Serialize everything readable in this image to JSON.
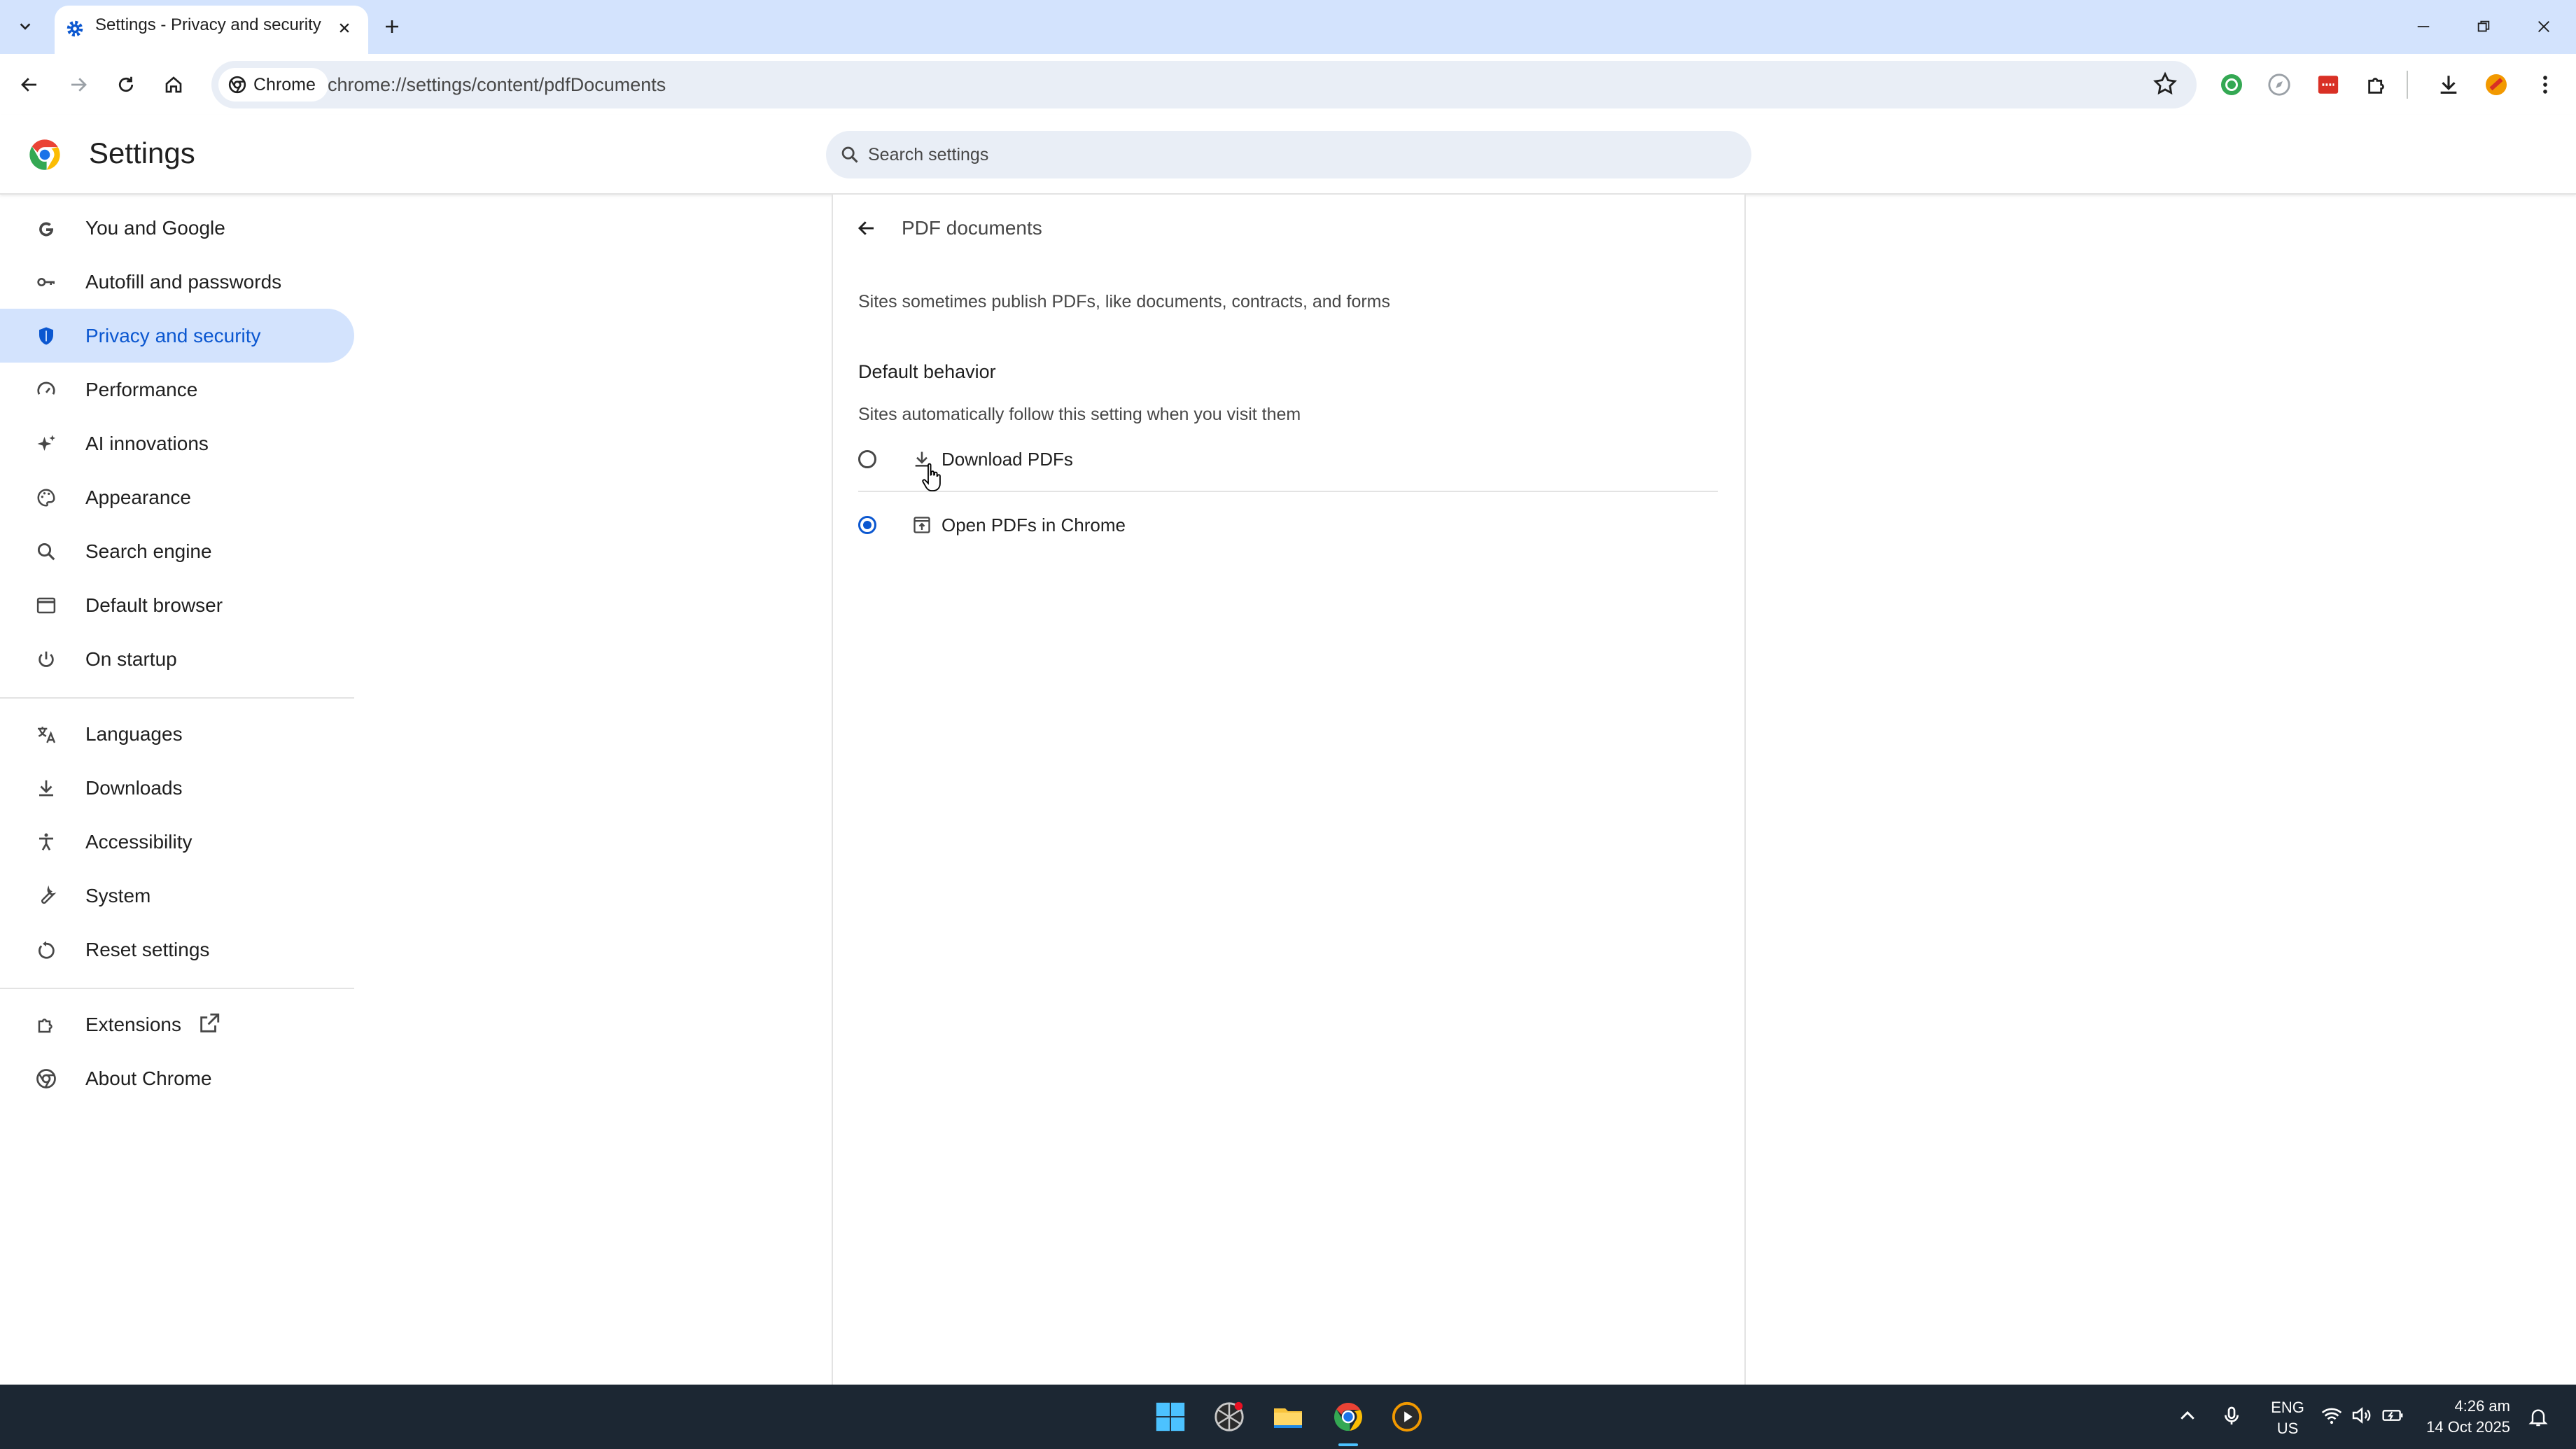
{
  "browser": {
    "tab": {
      "title": "Settings - Privacy and security"
    },
    "chip_label": "Chrome",
    "url": "chrome://settings/content/pdfDocuments"
  },
  "settings": {
    "title": "Settings",
    "search_placeholder": "Search settings"
  },
  "sidebar": {
    "items": [
      {
        "label": "You and Google",
        "icon": "google-g-icon"
      },
      {
        "label": "Autofill and passwords",
        "icon": "key-icon"
      },
      {
        "label": "Privacy and security",
        "icon": "shield-icon",
        "active": true
      },
      {
        "label": "Performance",
        "icon": "speedometer-icon"
      },
      {
        "label": "AI innovations",
        "icon": "sparkle-icon"
      },
      {
        "label": "Appearance",
        "icon": "palette-icon"
      },
      {
        "label": "Search engine",
        "icon": "search-icon"
      },
      {
        "label": "Default browser",
        "icon": "browser-window-icon"
      },
      {
        "label": "On startup",
        "icon": "power-icon"
      },
      {
        "label": "Languages",
        "icon": "translate-icon"
      },
      {
        "label": "Downloads",
        "icon": "download-icon"
      },
      {
        "label": "Accessibility",
        "icon": "accessibility-icon"
      },
      {
        "label": "System",
        "icon": "wrench-icon"
      },
      {
        "label": "Reset settings",
        "icon": "reset-icon"
      },
      {
        "label": "Extensions",
        "icon": "puzzle-icon"
      },
      {
        "label": "About Chrome",
        "icon": "chrome-icon"
      }
    ]
  },
  "page": {
    "title": "PDF documents",
    "description": "Sites sometimes publish PDFs, like documents, contracts, and forms",
    "section_title": "Default behavior",
    "section_description": "Sites automatically follow this setting when you visit them",
    "options": [
      {
        "label": "Download PDFs",
        "icon": "download-icon",
        "selected": false
      },
      {
        "label": "Open PDFs in Chrome",
        "icon": "open-in-browser-icon",
        "selected": true
      }
    ]
  },
  "taskbar": {
    "language": "ENG",
    "region": "US",
    "time": "4:26 am",
    "date": "14 Oct 2025"
  },
  "colors": {
    "accent": "#0b57d0",
    "active_nav_bg": "#d3e3fd",
    "tab_strip_bg": "#d3e3fd",
    "taskbar_bg": "#1c2733"
  }
}
